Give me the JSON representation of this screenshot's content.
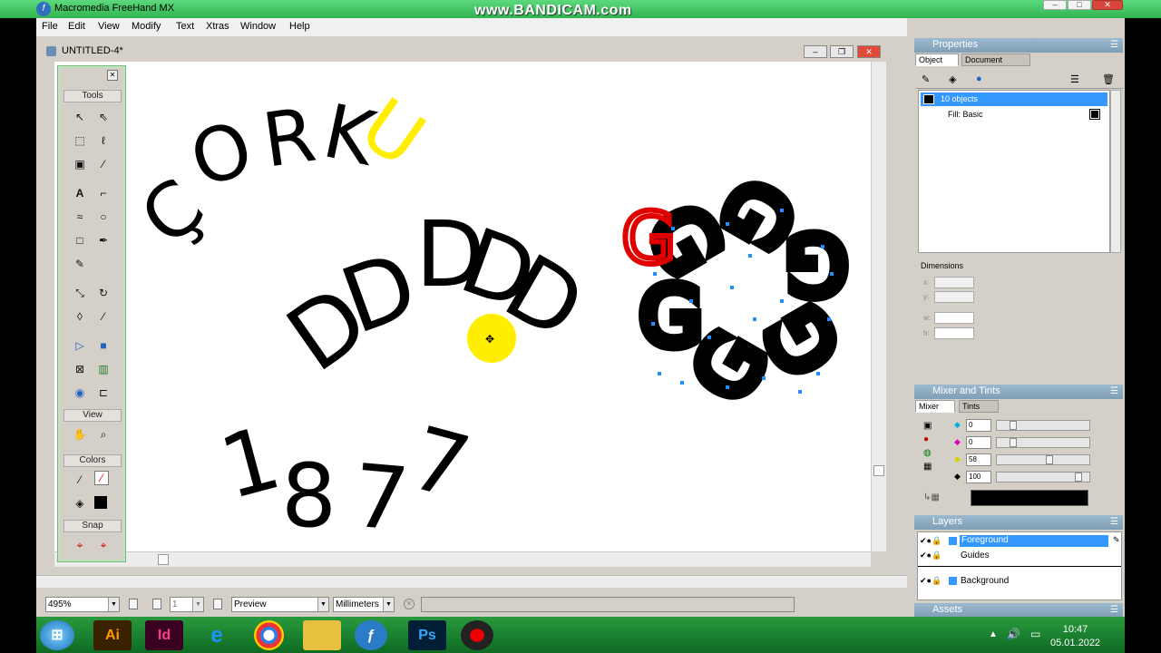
{
  "window": {
    "title": "Macromedia FreeHand MX",
    "watermark": "www.BANDICAM.com"
  },
  "menu": [
    "File",
    "Edit",
    "View",
    "Modify",
    "Text",
    "Xtras",
    "Window",
    "Help"
  ],
  "document": {
    "title": "UNTITLED-4*"
  },
  "canvas": {
    "word_top": [
      "Ç",
      "O",
      "R",
      "K",
      "U"
    ],
    "word_middle": [
      "D",
      "D",
      "D",
      "D",
      "D"
    ],
    "word_bottom": [
      "1",
      "8",
      "7",
      "7"
    ],
    "flower_letter": "G",
    "colors": {
      "black": "#000000",
      "yellow": "#ffee00",
      "red": "#e00000",
      "handle": "#1e90ff"
    }
  },
  "tools": {
    "sections": [
      "Tools",
      "View",
      "Colors",
      "Snap"
    ],
    "icons": [
      "pointer-icon",
      "subselect-icon",
      "lasso-icon",
      "freeform-lasso-icon",
      "page-icon",
      "eyedropper-icon",
      "text-icon",
      "rectangle-icon",
      "polygon-icon",
      "ellipse-icon",
      "line-icon",
      "pen-icon",
      "pencil-icon",
      "knife-icon",
      "scale-icon",
      "rotate-icon",
      "eraser-icon",
      "brush-icon",
      "fill-icon",
      "gradient-icon",
      "mesh-icon",
      "blend-icon",
      "link-icon",
      "connector-icon",
      "hand-icon",
      "zoom-icon",
      "stroke-color-icon",
      "none-icon",
      "fill-color-icon",
      "black-swatch-icon",
      "snap-icon",
      "snap-alt-icon"
    ]
  },
  "statusbar": {
    "zoom": "495%",
    "page": "1",
    "view_mode": "Preview",
    "units": "Millimeters"
  },
  "properties": {
    "title": "Properties",
    "tabs": [
      "Object",
      "Document"
    ],
    "selection": "10 objects",
    "fill": "Fill: Basic",
    "dimensions_label": "Dimensions",
    "dim_labels": [
      "x:",
      "y:",
      "w:",
      "h:"
    ]
  },
  "mixer": {
    "title": "Mixer and Tints",
    "tabs": [
      "Mixer",
      "Tints"
    ],
    "values": [
      "0",
      "0",
      "58",
      "100"
    ]
  },
  "layers": {
    "title": "Layers",
    "items": [
      "Foreground",
      "Guides",
      "Background"
    ]
  },
  "assets": {
    "title": "Assets"
  },
  "taskbar": {
    "apps": [
      "Ai",
      "Id",
      "e",
      "",
      "",
      "",
      "Ps",
      ""
    ],
    "time": "10:47",
    "date": "05.01.2022"
  }
}
